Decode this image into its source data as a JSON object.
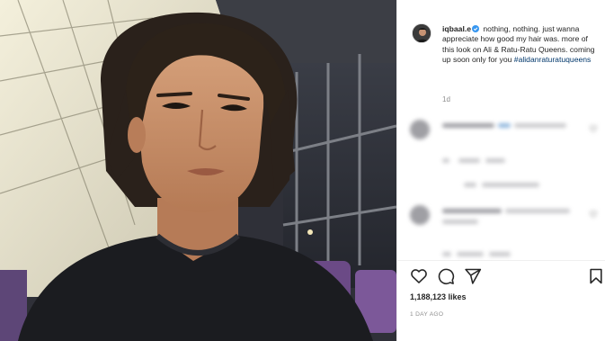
{
  "post": {
    "username": "iqbaal.e",
    "caption": "nothing, nothing. just wanna appreciate how good my hair was. more of this look on Ali & Ratu-Ratu Queens. coming up soon only for you",
    "hashtag": "#alidanraturatuqueens",
    "caption_time": "1d",
    "likes": "1,188,123 likes",
    "posted": "1 DAY AGO"
  },
  "icons": {
    "verified": "verified-badge-icon",
    "like": "heart-icon",
    "comment": "comment-bubble-icon",
    "share": "paper-plane-icon",
    "save": "bookmark-icon"
  },
  "colors": {
    "verified": "#3897f0",
    "hashtag": "#00376b",
    "muted": "#8e8e8e",
    "text": "#262626"
  }
}
